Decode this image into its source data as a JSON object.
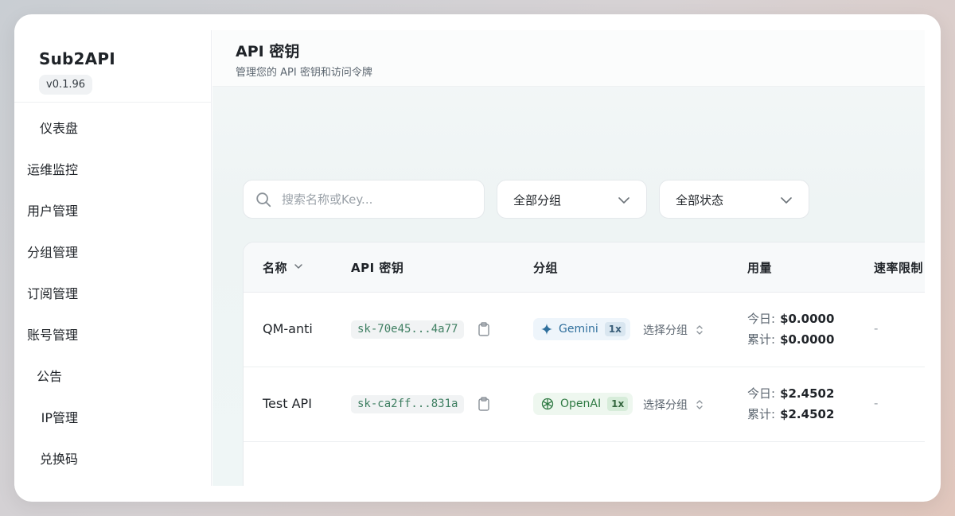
{
  "sidebar": {
    "brand": "Sub2API",
    "version": "v0.1.96",
    "items": [
      {
        "label": "仪表盘"
      },
      {
        "label": "运维监控"
      },
      {
        "label": "用户管理"
      },
      {
        "label": "分组管理"
      },
      {
        "label": "订阅管理"
      },
      {
        "label": "账号管理"
      },
      {
        "label": "公告"
      },
      {
        "label": "IP管理"
      },
      {
        "label": "兑换码"
      }
    ]
  },
  "header": {
    "title": "API 密钥",
    "subtitle": "管理您的 API 密钥和访问令牌"
  },
  "filters": {
    "search_placeholder": "搜索名称或Key...",
    "group_select": "全部分组",
    "status_select": "全部状态"
  },
  "table": {
    "columns": {
      "name": "名称",
      "key": "API 密钥",
      "group": "分组",
      "usage": "用量",
      "rate": "速率限制"
    },
    "rows": [
      {
        "name": "QM-anti",
        "key": "sk-70e45...4a77",
        "group": "Gemini",
        "group_icon": "gemini-icon",
        "multiplier": "1x",
        "select_group": "选择分组",
        "today_label": "今日:",
        "today": "$0.0000",
        "total_label": "累计:",
        "total": "$0.0000",
        "rate": "-"
      },
      {
        "name": "Test API",
        "key": "sk-ca2ff...831a",
        "group": "OpenAI",
        "group_icon": "openai-icon",
        "multiplier": "1x",
        "select_group": "选择分组",
        "today_label": "今日:",
        "today": "$2.4502",
        "total_label": "累计:",
        "total": "$2.4502",
        "rate": "-"
      }
    ]
  },
  "colors": {
    "gemini_accent": "#2f6f9c",
    "openai_accent": "#2f7a43",
    "key_text": "#3f7f62"
  }
}
